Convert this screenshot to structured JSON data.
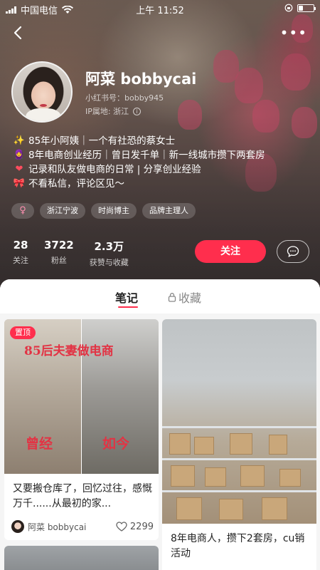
{
  "status_bar": {
    "carrier": "中国电信",
    "time": "上午 11:52",
    "battery_level": 0.3
  },
  "profile": {
    "name": "阿菜 bobbycai",
    "xhs_id": "小红书号：bobby945",
    "ip_location": "IP属地: 浙江",
    "bio": [
      {
        "emoji": "✨",
        "text": "85年小阿姨｜一个有社恐的蔡女士"
      },
      {
        "emoji": "🧕",
        "text": "8年电商创业经历｜曾日发千单｜新一线城市攒下两套房"
      },
      {
        "emoji": "❤",
        "text": "记录和队友做电商的日常 | 分享创业经验"
      },
      {
        "emoji": "🎀",
        "text": "不看私信，评论区见～"
      }
    ],
    "tags": [
      "♀",
      "浙江宁波",
      "时尚博主",
      "品牌主理人"
    ],
    "stats": [
      {
        "value": "28",
        "label": "关注"
      },
      {
        "value": "3722",
        "label": "粉丝"
      },
      {
        "value": "2.3万",
        "label": "获赞与收藏"
      }
    ],
    "follow_label": "关注"
  },
  "tabs": {
    "notes": "笔记",
    "collections": "收藏"
  },
  "notes": [
    {
      "pin_label": "置顶",
      "image_text_top": "85后夫妻做电商",
      "image_text_before": "曾经",
      "image_text_now": "如今",
      "title": "又要搬仓库了，回忆过往，感慨万千......从最初的家...",
      "author": "阿菜 bobbycai",
      "likes": "2299"
    },
    {
      "title": "8年电商人，攒下2套房，cu销活动"
    }
  ],
  "colors": {
    "accent": "#ff2e4d",
    "overlay_text": "#e23344"
  }
}
